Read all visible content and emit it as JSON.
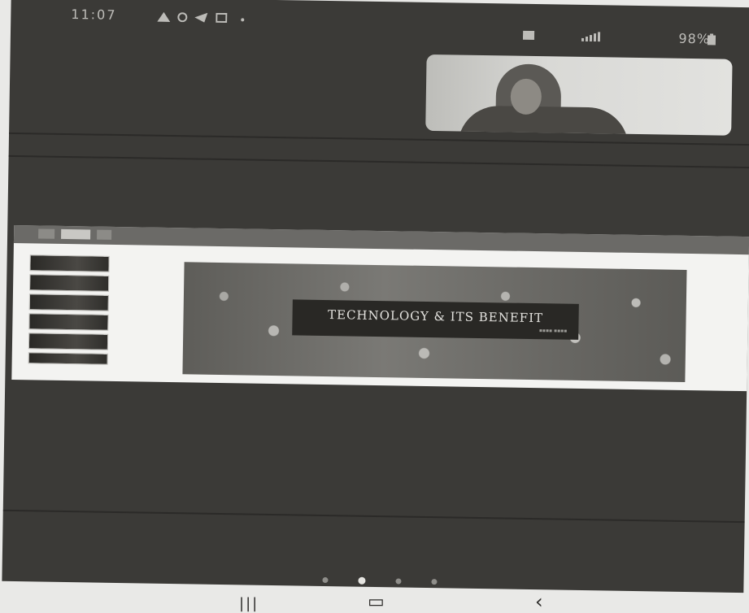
{
  "status_bar": {
    "time": "11:07",
    "battery": "98%",
    "icons": [
      "warning-icon",
      "whatsapp-icon",
      "navigation-icon",
      "gallery-icon",
      "dot-icon",
      "wifi-icon",
      "signal-icon",
      "battery-icon"
    ]
  },
  "presentation": {
    "slide_title": "TECHNOLOGY & ITS BENEFIT",
    "thumbnail_count": 6
  },
  "pager": {
    "pages": 4,
    "active_index": 1
  },
  "navigation": {
    "recent_apps_symbol": "|||",
    "home_symbol": "▭",
    "back_symbol": "‹"
  },
  "colors": {
    "screen_background": "#3b3a37",
    "slide_background": "#f3f3f1",
    "title_box": "#292825"
  }
}
